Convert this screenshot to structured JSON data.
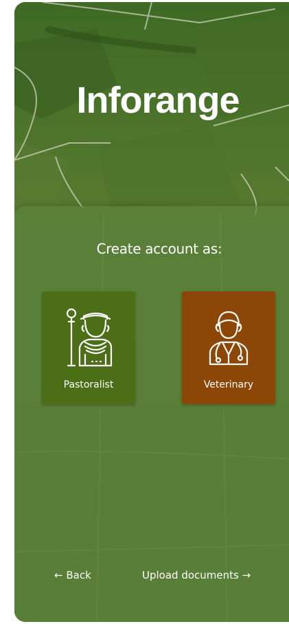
{
  "app": {
    "name": "Inforange"
  },
  "registration": {
    "title": "Create account as:",
    "roles": [
      {
        "label": "Pastoralist",
        "icon": "herder-icon",
        "color": "#4b6e17"
      },
      {
        "label": "Veterinary",
        "icon": "doctor-icon",
        "color": "#8c4706"
      }
    ]
  },
  "navigation": {
    "back_label": "Back",
    "back_icon": "arrow-left-icon",
    "next_label": "Upload documents",
    "next_icon": "arrow-right-icon"
  },
  "theme": {
    "background_green": "#55772f",
    "panel_green": "#5c823a"
  }
}
